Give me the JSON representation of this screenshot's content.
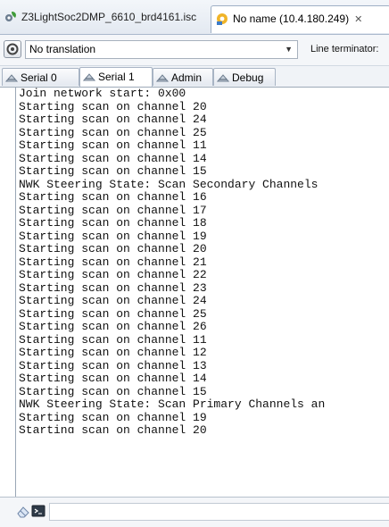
{
  "editor_tabs": [
    {
      "label": "Z3LightSoc2DMP_6610_brd4161.isc",
      "icon": "gear-leaf-icon",
      "active": false
    },
    {
      "label": "No name (10.4.180.249)",
      "icon": "network-device-icon",
      "active": true,
      "close": "✕"
    }
  ],
  "toolbar": {
    "translation_value": "No translation",
    "line_terminator_label": "Line terminator:"
  },
  "sub_tabs": [
    {
      "label": "Serial 0",
      "icon": "serial-port-icon"
    },
    {
      "label": "Serial 1",
      "icon": "serial-port-icon",
      "selected": true
    },
    {
      "label": "Admin",
      "icon": "serial-port-icon"
    },
    {
      "label": "Debug",
      "icon": "serial-port-icon"
    }
  ],
  "console_lines": [
    "Join network start: 0x00",
    "Starting scan on channel 20",
    "Starting scan on channel 24",
    "Starting scan on channel 25",
    "Starting scan on channel 11",
    "Starting scan on channel 14",
    "Starting scan on channel 15",
    "NWK Steering State: Scan Secondary Channels",
    "Starting scan on channel 16",
    "Starting scan on channel 17",
    "Starting scan on channel 18",
    "Starting scan on channel 19",
    "Starting scan on channel 20",
    "Starting scan on channel 21",
    "Starting scan on channel 22",
    "Starting scan on channel 23",
    "Starting scan on channel 24",
    "Starting scan on channel 25",
    "Starting scan on channel 26",
    "Starting scan on channel 11",
    "Starting scan on channel 12",
    "Starting scan on channel 13",
    "Starting scan on channel 14",
    "Starting scan on channel 15",
    "NWK Steering State: Scan Primary Channels an",
    "Starting scan on channel 19",
    "Starting scan on channel 20"
  ],
  "bottom_bar": {
    "icons": [
      "eraser-icon",
      "terminal-icon"
    ],
    "command_value": ""
  }
}
